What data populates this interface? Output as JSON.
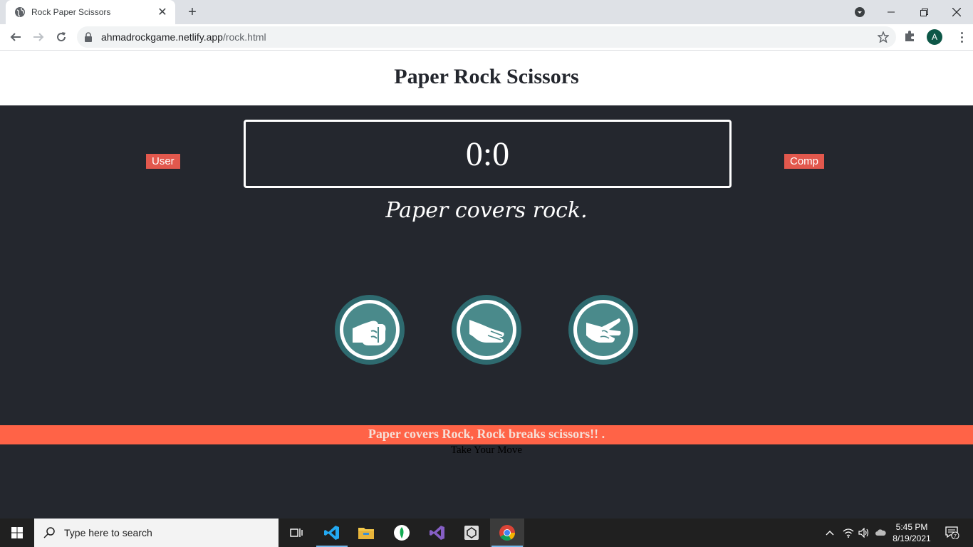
{
  "browser": {
    "tab_title": "Rock Paper Scissors",
    "url_host": "ahmadrockgame.netlify.app",
    "url_path": "/rock.html",
    "profile_initial": "A"
  },
  "page": {
    "title": "Paper Rock Scissors",
    "user_label": "User",
    "comp_label": "Comp",
    "score": "0:0",
    "result_message": "Paper covers rock.",
    "choices": [
      "rock",
      "paper",
      "scissors"
    ],
    "banner": "Paper covers Rock, Rock breaks scissors!! .",
    "move_prompt": "Take Your Move"
  },
  "taskbar": {
    "search_placeholder": "Type here to search",
    "time": "5:45 PM",
    "date": "8/19/2021",
    "notification_count": "7"
  },
  "colors": {
    "background": "#24272e",
    "badge": "#e2584d",
    "banner": "#ff6347",
    "choice_ring": "#2e6a6f"
  }
}
